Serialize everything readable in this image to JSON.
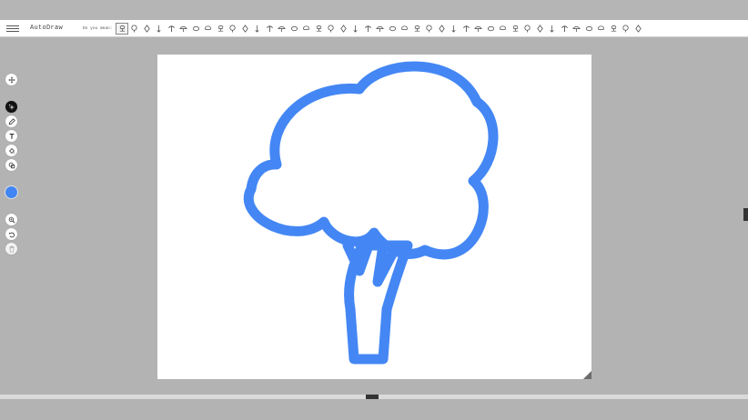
{
  "app": {
    "title": "AutoDraw"
  },
  "toolbar": {
    "suggestion_prompt": "Do you mean:",
    "suggestions": [
      "broccoli-suggestion",
      "tree-suggestion",
      "balloon-suggestion",
      "lightbulb-suggestion",
      "palm-tree-suggestion",
      "umbrella-suggestion",
      "sketch-suggestion",
      "mushroom-suggestion",
      "cloud-suggestion",
      "tree-outline-suggestion",
      "cloud-outline-suggestion",
      "flower-suggestion",
      "splat-suggestion",
      "speech-bubble-suggestion",
      "cauliflower-suggestion",
      "pizza-suggestion",
      "bush-suggestion",
      "traffic-light-suggestion",
      "popsicle-suggestion",
      "bulb-suggestion",
      "tree-round-suggestion",
      "lamp-suggestion",
      "bottle-suggestion",
      "cone-suggestion",
      "hat-suggestion",
      "leaves-suggestion",
      "fish-suggestion",
      "cloud-small-suggestion",
      "eye-suggestion",
      "hand-suggestion",
      "chef-hat-suggestion",
      "house-suggestion",
      "train-suggestion",
      "bird-suggestion",
      "plane-suggestion",
      "bee-suggestion",
      "grass-suggestion",
      "tree-icon-suggestion",
      "ladder-suggestion",
      "bar-suggestion",
      "fence-suggestion",
      "gate-suggestion",
      "grid-suggestion"
    ],
    "selected_index": 0
  },
  "tools": [
    "move-icon",
    "autodraw-icon",
    "draw-icon",
    "type-icon",
    "fill-icon",
    "shape-icon"
  ],
  "bottom_tools": [
    "zoom-icon",
    "undo-icon",
    "delete-icon"
  ],
  "colors": {
    "current": "#4285f4",
    "stroke": "#4487f4",
    "active_tool": "#111111"
  }
}
